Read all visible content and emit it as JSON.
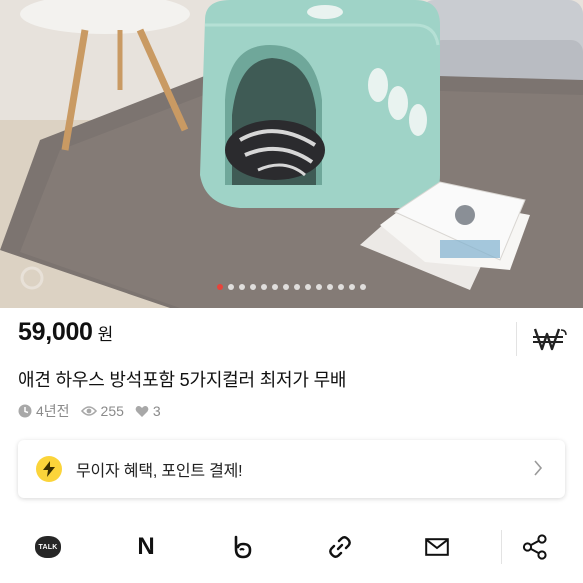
{
  "gallery": {
    "image_alt": "Mint dice-shaped pet house on a gray shag rug",
    "slide_count": 14,
    "active_index": 0
  },
  "product": {
    "price": "59,000",
    "currency_unit": "원",
    "title": "애견 하우스 방석포함 5가지컬러 최저가 무배",
    "meta": {
      "posted": "4년전",
      "views": "255",
      "likes": "3"
    }
  },
  "benefit": {
    "text": "무이자 혜택, 포인트 결제!"
  },
  "share": {
    "kakaotalk_label": "TALK",
    "naver_label": "N"
  },
  "colors": {
    "accent_dot": "#e8433a",
    "bolt_badge": "#fbd43a",
    "house_mint": "#9fd3c7"
  },
  "icons": [
    "pay-won-icon",
    "clock-icon",
    "eye-icon",
    "heart-icon",
    "lightning-icon",
    "chevron-right-icon",
    "kakaotalk-icon",
    "naver-icon",
    "band-icon",
    "link-icon",
    "mail-icon",
    "share-icon"
  ]
}
